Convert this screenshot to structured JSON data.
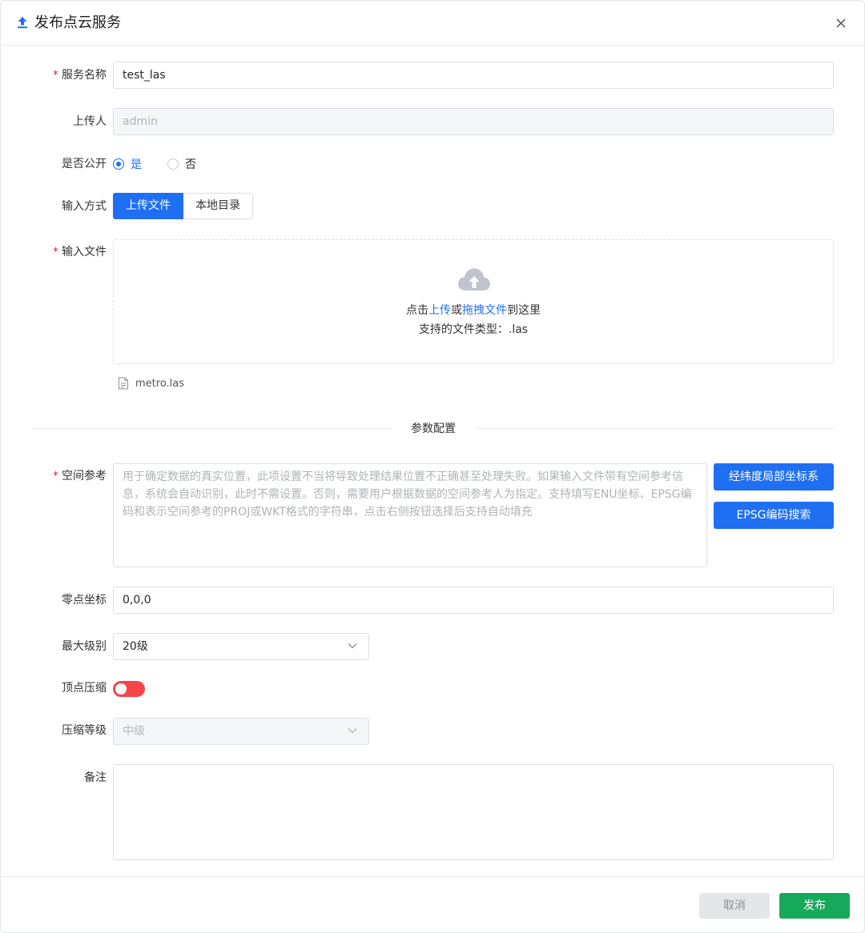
{
  "dialog": {
    "title": "发布点云服务",
    "upload_icon": "upload-icon",
    "close_icon": "close-icon"
  },
  "form": {
    "service_name": {
      "label": "服务名称",
      "value": "test_las"
    },
    "uploader": {
      "label": "上传人",
      "value": "admin"
    },
    "public": {
      "label": "是否公开",
      "options": [
        "是",
        "否"
      ],
      "selected": "是"
    },
    "input_method": {
      "label": "输入方式",
      "options": [
        "上传文件",
        "本地目录"
      ],
      "selected": "上传文件"
    },
    "input_file": {
      "label": "输入文件",
      "prompt_prefix": "点击",
      "prompt_upload": "上传",
      "prompt_or": "或",
      "prompt_drag": "拖拽文件",
      "prompt_suffix": "到这里",
      "supported_types": "支持的文件类型：.las",
      "files": [
        "metro.las"
      ]
    },
    "section_title": "参数配置",
    "spatial_ref": {
      "label": "空间参考",
      "placeholder": "用于确定数据的真实位置，此项设置不当将导致处理结果位置不正确甚至处理失败。如果输入文件带有空间参考信息，系统会自动识别，此时不需设置。否则，需要用户根据数据的空间参考人为指定。支持填写ENU坐标、EPSG编码和表示空间参考的PROJ或WKT格式的字符串，点击右侧按钮选择后支持自动填充",
      "btn_local": "经纬度局部坐标系",
      "btn_epsg": "EPSG编码搜索"
    },
    "origin": {
      "label": "零点坐标",
      "value": "0,0,0"
    },
    "max_level": {
      "label": "最大级别",
      "value": "20级"
    },
    "vertex_compression": {
      "label": "顶点压缩",
      "enabled": true
    },
    "compression_level": {
      "label": "压缩等级",
      "value": "中级"
    },
    "remark": {
      "label": "备注",
      "value": ""
    }
  },
  "footer": {
    "cancel": "取消",
    "publish": "发布"
  },
  "colors": {
    "primary": "#1f6ff2",
    "success": "#17a95a",
    "danger": "#f5454b"
  }
}
